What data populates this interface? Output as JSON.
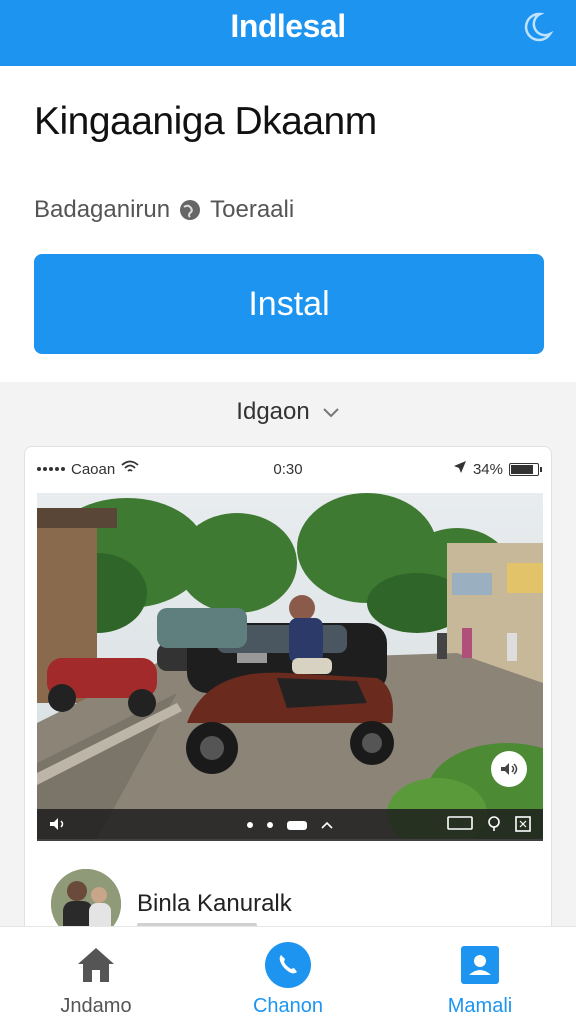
{
  "topbar": {
    "title": "Indlesal",
    "icon": "moon-icon"
  },
  "header": {
    "app_name": "Kingaaniga Dkaanm",
    "meta_left": "Badaganirun",
    "meta_right": "Toeraali",
    "meta_icon": "globe-icon"
  },
  "install": {
    "label": "Instal"
  },
  "section": {
    "title": "Idgaon"
  },
  "preview": {
    "statusbar": {
      "carrier": "Caoan",
      "time": "0:30",
      "battery": "34%"
    },
    "profile": {
      "name": "Binla Kanuralk"
    }
  },
  "nav": {
    "items": [
      {
        "label": "Jndamo",
        "icon": "home-icon"
      },
      {
        "label": "Chanon",
        "icon": "phone-icon"
      },
      {
        "label": "Mamali",
        "icon": "contact-icon"
      }
    ]
  },
  "colors": {
    "accent": "#1d95f0",
    "background": "#ffffff",
    "section_bg": "#f3f3f3"
  }
}
